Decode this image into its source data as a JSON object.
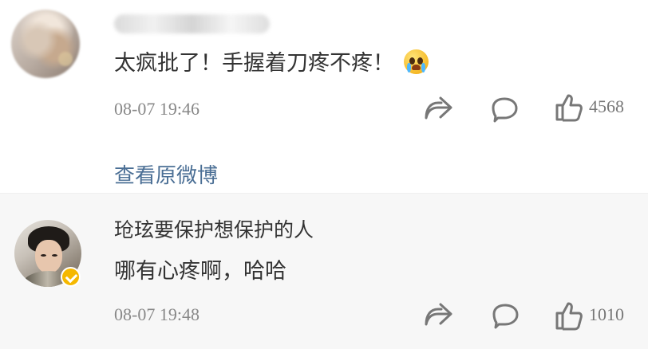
{
  "comments": [
    {
      "text": "太疯批了！手握着刀疼不疼！",
      "emoji": "crying-emoji",
      "time": "08-07 19:46",
      "actions": {
        "share_icon": "share-icon",
        "comment_icon": "comment-icon",
        "like_icon": "thumb-up-icon",
        "like_count": "4568"
      }
    },
    {
      "username": "玱玹要保护想保护的人",
      "text": "哪有心疼啊，哈哈",
      "time": "08-07 19:48",
      "verified_badge": "verified-badge-icon",
      "actions": {
        "share_icon": "share-icon",
        "comment_icon": "comment-icon",
        "like_icon": "thumb-up-icon",
        "like_count": "1010"
      }
    }
  ],
  "links": {
    "view_original": "查看原微博"
  },
  "colors": {
    "primary_text": "#333333",
    "meta_text": "#888888",
    "link": "#4b6f95",
    "reply_background": "#f7f7f7",
    "verified_badge": "#f5b800"
  }
}
